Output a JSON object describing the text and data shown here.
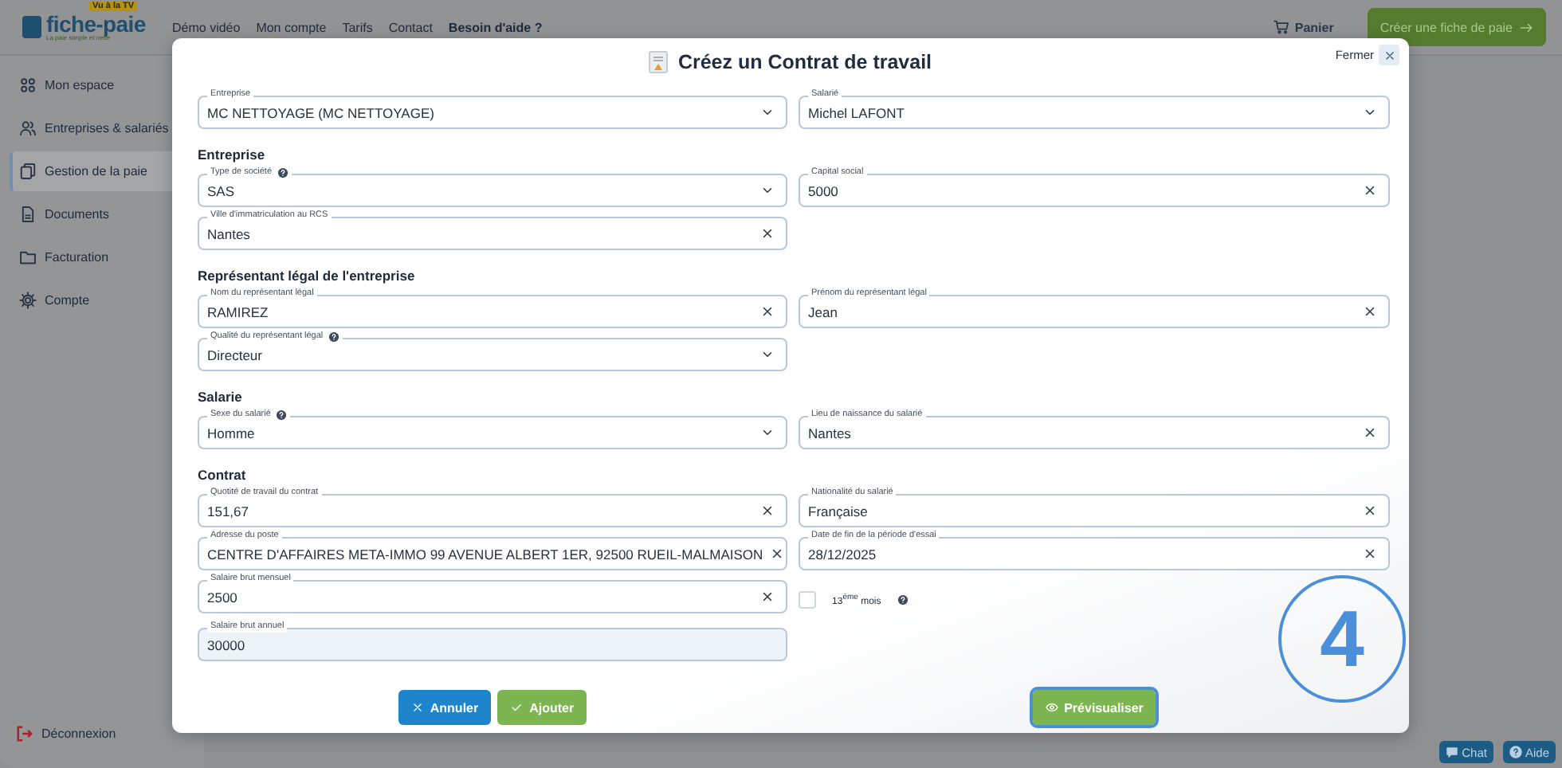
{
  "header": {
    "logo": {
      "badge": "Vu à la TV",
      "name": "fiche-paie",
      "tagline": "La paie simple et nette"
    },
    "nav": [
      {
        "label": "Démo vidéo",
        "bold": false
      },
      {
        "label": "Mon compte",
        "bold": false
      },
      {
        "label": "Tarifs",
        "bold": false
      },
      {
        "label": "Contact",
        "bold": false
      },
      {
        "label": "Besoin d'aide ?",
        "bold": true
      }
    ],
    "cart": "Panier",
    "cta": "Créer une fiche de paie"
  },
  "sidebar": {
    "items": [
      {
        "label": "Mon espace",
        "selected": false
      },
      {
        "label": "Entreprises & salariés",
        "selected": false
      },
      {
        "label": "Gestion de la paie",
        "selected": true
      },
      {
        "label": "Documents",
        "selected": false
      },
      {
        "label": "Facturation",
        "selected": false
      },
      {
        "label": "Compte",
        "selected": false
      }
    ],
    "logout": "Déconnexion"
  },
  "modal": {
    "title": "Créez un Contrat de travail",
    "close": "Fermer",
    "sections": [
      {
        "rows": [
          {
            "fields": [
              {
                "kind": "select",
                "label": "Entreprise",
                "value": "MC NETTOYAGE (MC NETTOYAGE)"
              },
              {
                "kind": "select",
                "label": "Salarié",
                "value": "Michel LAFONT"
              }
            ]
          }
        ]
      },
      {
        "heading": "Entreprise",
        "rows": [
          {
            "fields": [
              {
                "kind": "select",
                "label": "Type de société",
                "help": true,
                "value": "SAS"
              },
              {
                "kind": "text",
                "label": "Capital social",
                "value": "5000"
              }
            ]
          },
          {
            "fields": [
              {
                "kind": "text",
                "label": "Ville d'immatriculation au RCS",
                "value": "Nantes"
              }
            ]
          }
        ]
      },
      {
        "heading": "Représentant légal de l'entreprise",
        "rows": [
          {
            "fields": [
              {
                "kind": "text",
                "label": "Nom du représentant légal",
                "value": "RAMIREZ"
              },
              {
                "kind": "text",
                "label": "Prénom du représentant légal",
                "value": "Jean"
              }
            ]
          },
          {
            "fields": [
              {
                "kind": "select",
                "label": "Qualité du représentant légal",
                "help": true,
                "value": "Directeur"
              }
            ]
          }
        ]
      },
      {
        "heading": "Salarie",
        "rows": [
          {
            "fields": [
              {
                "kind": "select",
                "label": "Sexe du salarié",
                "help": true,
                "value": "Homme"
              },
              {
                "kind": "text",
                "label": "Lieu de naissance du salarié",
                "value": "Nantes"
              }
            ]
          }
        ]
      },
      {
        "heading": "Contrat",
        "rows": [
          {
            "fields": [
              {
                "kind": "text",
                "label": "Quotité de travail du contrat",
                "value": "151,67"
              },
              {
                "kind": "text",
                "label": "Nationalité du salarié",
                "value": "Française"
              }
            ]
          },
          {
            "fields": [
              {
                "kind": "text",
                "label": "Adresse du poste",
                "value": "CENTRE D'AFFAIRES META-IMMO 99 AVENUE ALBERT 1ER, 92500 RUEIL-MALMAISON"
              },
              {
                "kind": "text",
                "label": "Date de fin de la période d'essai",
                "value": "28/12/2025"
              }
            ]
          },
          {
            "fields": [
              {
                "kind": "text",
                "label": "Salaire brut mensuel",
                "value": "2500"
              },
              {
                "kind": "checkbox",
                "label": "13$^{ème}$ mois",
                "help": true,
                "checked": false
              }
            ]
          },
          {
            "fields": [
              {
                "kind": "readonly",
                "label": "Salaire brut annuel",
                "value": "30000"
              }
            ]
          }
        ]
      }
    ],
    "buttons": [
      {
        "kind": "cancel",
        "label": "Annuler",
        "highlighted": false
      },
      {
        "kind": "add",
        "label": "Ajouter",
        "highlighted": false
      },
      {
        "kind": "preview",
        "label": "Prévisualiser",
        "highlighted": true
      }
    ],
    "step_badge": "4"
  },
  "support": [
    {
      "kind": "chat",
      "label": "Chat"
    },
    {
      "kind": "help",
      "label": "Aide"
    }
  ]
}
